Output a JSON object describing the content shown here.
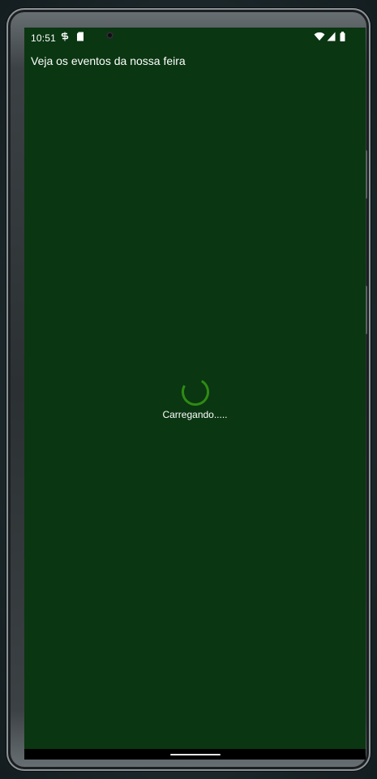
{
  "status_bar": {
    "time": "10:51",
    "left_icons": [
      "notification-s-icon",
      "sd-card-icon"
    ],
    "right_icons": [
      "wifi-icon",
      "cellular-signal-icon",
      "battery-icon"
    ]
  },
  "header": {
    "title": "Veja os eventos da nossa feira"
  },
  "loading": {
    "label": "Carregando.....",
    "spinner_color": "#2e8b12"
  },
  "colors": {
    "background": "#0a3612",
    "text": "#ffffff",
    "nav_bar": "#000000"
  }
}
